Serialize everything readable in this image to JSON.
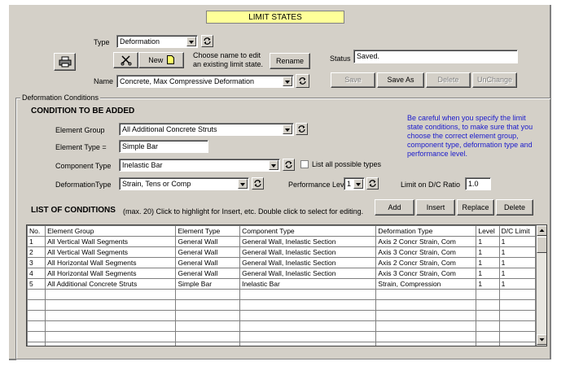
{
  "window": {
    "title": "LIMIT STATES"
  },
  "top": {
    "type_label": "Type",
    "type_value": "Deformation",
    "new_label": "New",
    "choose_hint_line1": "Choose name to edit",
    "choose_hint_line2": "an existing limit state.",
    "rename_label": "Rename",
    "name_label": "Name",
    "name_value": "Concrete, Max Compressive Deformation",
    "status_label": "Status",
    "status_value": "Saved.",
    "save_label": "Save",
    "save_as_label": "Save As",
    "delete_label": "Delete",
    "unchange_label": "UnChange"
  },
  "conditions": {
    "group_title": "Deformation Conditions",
    "section_title": "CONDITION TO BE ADDED",
    "element_group_label": "Element Group",
    "element_group_value": "All Additional Concrete Struts",
    "element_type_label": "Element Type =",
    "element_type_value": "Simple Bar",
    "component_type_label": "Component Type",
    "component_type_value": "Inelastic Bar",
    "list_all_label": "List all possible types",
    "deformation_type_label": "DeformationType",
    "deformation_type_value": "Strain, Tens or Comp",
    "performance_level_label": "Performance Level",
    "performance_level_value": "1",
    "limit_label": "Limit on D/C Ratio",
    "limit_value": "1.0",
    "note": "Be careful when you specify the limit state conditions, to make sure that you choose the correct element group, component type, deformation type and performance level.",
    "list_title": "LIST OF CONDITIONS",
    "list_sub": "(max. 20)  Click to highlight for Insert, etc. Double click to select for editing.",
    "add_label": "Add",
    "insert_label": "Insert",
    "replace_label": "Replace",
    "delete_label": "Delete"
  },
  "table": {
    "headers": [
      "No.",
      "Element Group",
      "Element Type",
      "Component Type",
      "Deformation Type",
      "Level",
      "D/C Limit"
    ],
    "rows": [
      [
        "1",
        "All Vertical Wall Segments",
        "General Wall",
        "General Wall, Inelastic Section",
        "Axis 2 Concr Strain, Com",
        "1",
        "1"
      ],
      [
        "2",
        "All Vertical Wall Segments",
        "General Wall",
        "General Wall, Inelastic Section",
        "Axis 3 Concr Strain, Com",
        "1",
        "1"
      ],
      [
        "3",
        "All Horizontal Wall Segments",
        "General Wall",
        "General Wall, Inelastic Section",
        "Axis 2 Concr Strain, Com",
        "1",
        "1"
      ],
      [
        "4",
        "All Horizontal Wall Segments",
        "General Wall",
        "General Wall, Inelastic Section",
        "Axis 3 Concr Strain, Com",
        "1",
        "1"
      ],
      [
        "5",
        "All Additional Concrete Struts",
        "Simple Bar",
        "Inelastic Bar",
        "Strain, Compression",
        "1",
        "1"
      ],
      [
        "",
        "",
        "",
        "",
        "",
        "",
        ""
      ],
      [
        "",
        "",
        "",
        "",
        "",
        "",
        ""
      ],
      [
        "",
        "",
        "",
        "",
        "",
        "",
        ""
      ],
      [
        "",
        "",
        "",
        "",
        "",
        "",
        ""
      ],
      [
        "",
        "",
        "",
        "",
        "",
        "",
        ""
      ],
      [
        "",
        "",
        "",
        "",
        "",
        "",
        ""
      ],
      [
        "",
        "",
        "",
        "",
        "",
        "",
        ""
      ],
      [
        "",
        "",
        "",
        "",
        "",
        "",
        ""
      ]
    ]
  },
  "icons": {
    "printer": "printer-icon",
    "scissors": "scissors-icon",
    "new_doc": "new-document-icon",
    "refresh": "refresh-icon"
  }
}
